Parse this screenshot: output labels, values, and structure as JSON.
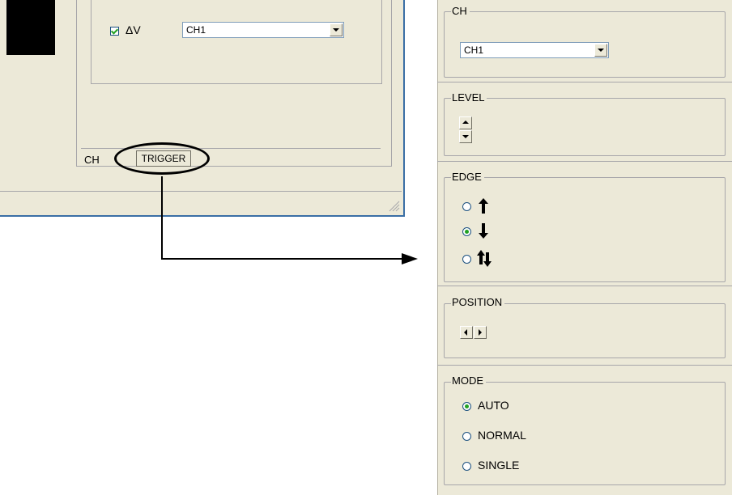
{
  "left_window": {
    "delta_v_label": "ΔV",
    "delta_v_checked": true,
    "delta_v_channel": "CH1",
    "tabs": [
      "CH",
      "TRIGGER"
    ],
    "selected_tab": "TRIGGER"
  },
  "trigger_panel": {
    "ch_group": {
      "title": "CH",
      "selected": "CH1"
    },
    "level_group": {
      "title": "LEVEL"
    },
    "edge_group": {
      "title": "EDGE",
      "options": [
        {
          "icon": "rising-edge-arrow-icon",
          "glyph": "↑",
          "selected": false
        },
        {
          "icon": "falling-edge-arrow-icon",
          "glyph": "↓",
          "selected": true
        },
        {
          "icon": "both-edges-arrow-icon",
          "glyph": "⇅",
          "selected": false
        }
      ]
    },
    "position_group": {
      "title": "POSITION"
    },
    "mode_group": {
      "title": "MODE",
      "options": [
        {
          "label": "AUTO",
          "selected": true
        },
        {
          "label": "NORMAL",
          "selected": false
        },
        {
          "label": "SINGLE",
          "selected": false
        }
      ]
    }
  },
  "colors": {
    "panel_bg": "#ece9d8",
    "window_border": "#3a6ea5",
    "radio_dot": "#21a121"
  }
}
